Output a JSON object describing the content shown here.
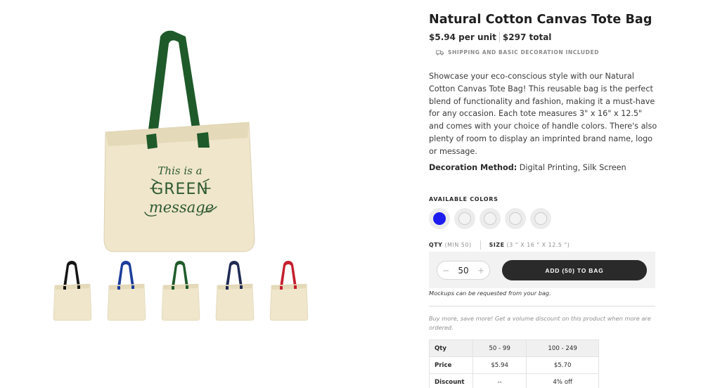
{
  "product": {
    "title": "Natural Cotton Canvas Tote Bag",
    "unit_price": "$5.94 per unit",
    "total_price": "$297 total",
    "shipping_note": "SHIPPING AND BASIC DECORATION INCLUDED",
    "description": "Showcase your eco-conscious style with our Natural Cotton Canvas Tote Bag! This reusable bag is the perfect blend of functionality and fashion, making it a must-have for any occasion. Each tote measures 3\" x 16\" x 12.5\" and comes with your choice of handle colors. There's also plenty of room to display an imprinted brand name, logo or message.",
    "decoration_label": "Decoration Method:",
    "decoration_value": "Digital Printing, Silk Screen"
  },
  "gallery": {
    "main_image": {
      "print_line1": "This is a",
      "print_line2": "GREEN",
      "print_line3": "message",
      "handle_color": "#1f5a2a",
      "print_color": "#2f5a32",
      "canvas_color": "#efe6cb"
    },
    "thumbnails": [
      {
        "handle_color": "#151515"
      },
      {
        "handle_color": "#1b3d9a"
      },
      {
        "handle_color": "#1f5a2a"
      },
      {
        "handle_color": "#1f2a55"
      },
      {
        "handle_color": "#c51f2e"
      }
    ]
  },
  "colors": {
    "heading": "AVAILABLE COLORS",
    "swatches": [
      {
        "color": "#1c1cf0",
        "selected": true
      },
      {
        "color": "#f3f3f3",
        "selected": false
      },
      {
        "color": "#f3f3f3",
        "selected": false
      },
      {
        "color": "#f3f3f3",
        "selected": false
      },
      {
        "color": "#f3f3f3",
        "selected": false
      }
    ]
  },
  "order": {
    "qty_label": "QTY",
    "qty_min": "(MIN 50)",
    "size_label": "SIZE",
    "size_value": "(3 \" X 16 \" X 12.5 \")",
    "quantity": "50",
    "minus_icon": "−",
    "plus_icon": "+",
    "add_button": "ADD (50) TO BAG",
    "mockup_note": "Mockups can be requested from your bag.",
    "volume_note": "Buy more, save more! Get a volume discount on this product when more are ordered."
  },
  "pricing_table": {
    "headers": [
      "Qty",
      "50 - 99",
      "100 - 249"
    ],
    "rows": [
      [
        "Price",
        "$5.94",
        "$5.70"
      ],
      [
        "Discount",
        "--",
        "4% off"
      ]
    ]
  }
}
